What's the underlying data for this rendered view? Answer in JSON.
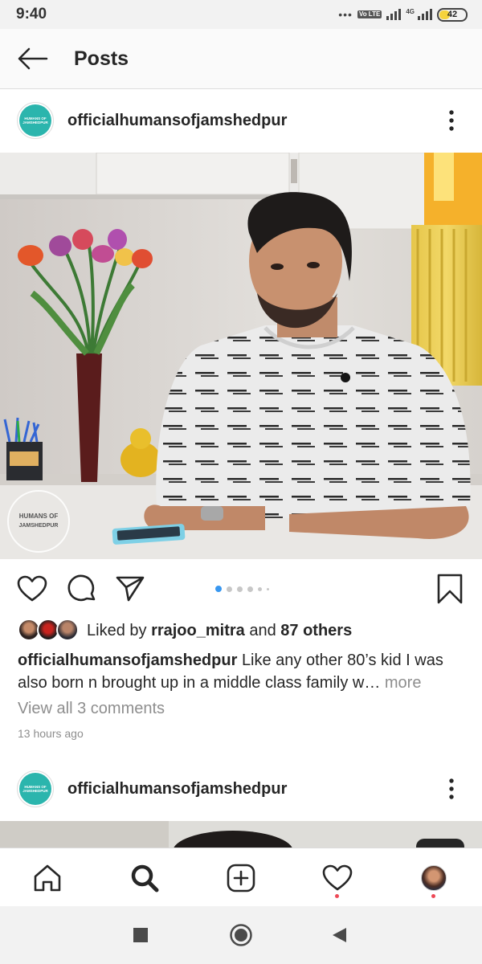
{
  "status_bar": {
    "time": "9:40",
    "network": "4G",
    "volte": "Vo LTE",
    "battery": "42",
    "battery_level": 0.42
  },
  "header": {
    "title": "Posts",
    "back_icon": "arrow-left-icon"
  },
  "posts": [
    {
      "username": "officialhumansofjamshedpur",
      "avatar_text": [
        "HUMANS OF",
        "JAMSHEDPUR"
      ],
      "watermark": [
        "HUMANS OF",
        "JAMSHEDPUR"
      ],
      "carousel": {
        "count": 6,
        "active": 0
      },
      "likes": {
        "prefix": "Liked by",
        "user": "rrajoo_mitra",
        "conjunction": "and",
        "others": "87 others"
      },
      "caption": {
        "username": "officialhumansofjamshedpur",
        "text": "Like any other 80’s kid I was also born n brought up in a middle class family w…",
        "more": "more"
      },
      "view_comments": "View all 3 comments",
      "time_ago": "13 hours ago"
    },
    {
      "username": "officialhumansofjamshedpur",
      "avatar_text": [
        "HUMANS OF",
        "JAMSHEDPUR"
      ]
    }
  ],
  "bottom_nav": [
    "home-icon",
    "search-icon",
    "new-post-icon",
    "activity-icon",
    "profile-avatar"
  ],
  "system_nav": [
    "recents-icon",
    "home-circle-icon",
    "back-triangle-icon"
  ],
  "colors": {
    "brand_teal": "#2bb5ad",
    "notification": "#ed4956",
    "carousel_active": "#3897f0",
    "text": "#262626",
    "muted": "#8e8e8e"
  }
}
